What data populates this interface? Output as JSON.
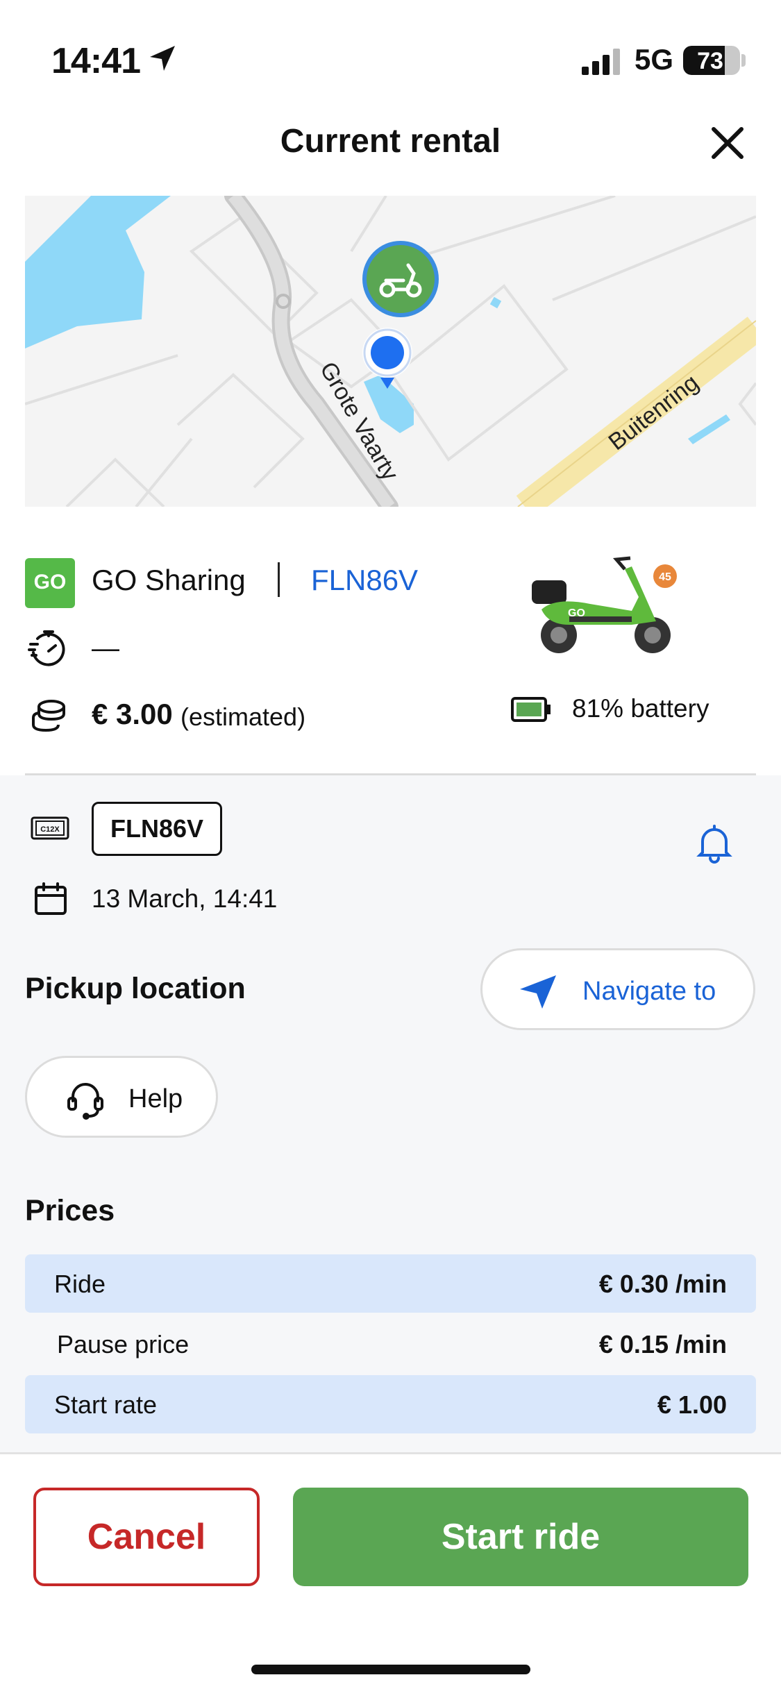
{
  "status_bar": {
    "time": "14:41",
    "network": "5G",
    "battery": "73",
    "battery_level": 0.73
  },
  "header": {
    "title": "Current rental"
  },
  "map": {
    "street_1": "Grote Vaarty",
    "street_2": "Buitenring"
  },
  "vehicle": {
    "logo_text": "GO",
    "provider": "GO Sharing",
    "plate": "FLN86V",
    "duration": "—",
    "price": "€ 3.00",
    "price_note": "(estimated)",
    "scooter_badge": "45",
    "battery_text": "81% battery",
    "battery_level": 0.81
  },
  "details": {
    "plate_icon_text": "C12X",
    "plate": "FLN86V",
    "date": "13 March, 14:41",
    "pickup_label": "Pickup location",
    "navigate_label": "Navigate to",
    "help_label": "Help"
  },
  "prices": {
    "title": "Prices",
    "rows": [
      {
        "label": "Ride",
        "value": "€ 0.30 /min"
      },
      {
        "label": "Pause price",
        "value": "€ 0.15 /min"
      },
      {
        "label": "Start rate",
        "value": "€ 1.00"
      }
    ]
  },
  "footer": {
    "cancel_label": "Cancel",
    "start_label": "Start ride"
  },
  "colors": {
    "accent_blue": "#1a63d6",
    "brand_green": "#5aa653",
    "cancel_red": "#c62828",
    "highlight_row": "#d9e7fb"
  }
}
